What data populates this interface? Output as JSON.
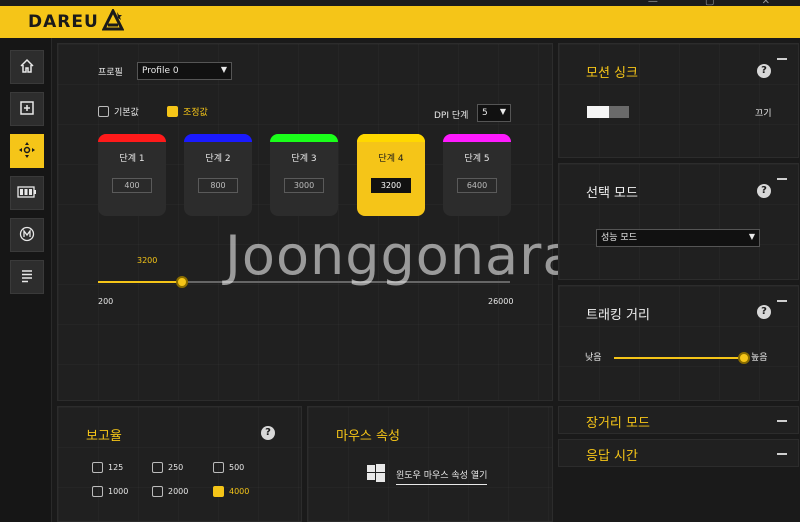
{
  "app": {
    "brand": "DAREU",
    "window_controls": "— ▢ ✕"
  },
  "sidebar": {
    "items": [
      {
        "name": "home",
        "icon": "home-icon",
        "glyph": "⌂"
      },
      {
        "name": "add",
        "icon": "plus-square-icon",
        "glyph": "⊞"
      },
      {
        "name": "dpi",
        "icon": "move-arrows-icon",
        "glyph": "✥"
      },
      {
        "name": "battery",
        "icon": "battery-icon",
        "glyph": "▮▮▮"
      },
      {
        "name": "macro",
        "icon": "macro-m-icon",
        "glyph": "Ⓜ"
      },
      {
        "name": "list",
        "icon": "list-icon",
        "glyph": "≡"
      }
    ],
    "active_index": 2
  },
  "dpi_panel": {
    "profile_label": "프로필",
    "profile_value": "Profile 0",
    "default_label": "기본값",
    "custom_label": "조정값",
    "default_checked": false,
    "custom_checked": true,
    "dpi_stage_label": "DPI 단계",
    "dpi_stage_value": "5",
    "stages": [
      {
        "label": "단계  1",
        "value": "400",
        "color": "#ff1a1a"
      },
      {
        "label": "단계  2",
        "value": "800",
        "color": "#1a1aff"
      },
      {
        "label": "단계  3",
        "value": "3000",
        "color": "#1aff1a"
      },
      {
        "label": "단계  4",
        "value": "3200",
        "color": "#ffd800"
      },
      {
        "label": "단계  5",
        "value": "6400",
        "color": "#ff1aff"
      }
    ],
    "active_stage": 3,
    "slider": {
      "value": "3200",
      "min": "200",
      "max": "26000"
    }
  },
  "motion_sync": {
    "title": "모션 싱크",
    "state_label": "끄기",
    "help": "?",
    "on": false
  },
  "select_mode": {
    "title": "선택 모드",
    "help": "?",
    "value": "성능 모드"
  },
  "tracking": {
    "title": "트래킹 거리",
    "help": "?",
    "low_label": "낮음",
    "high_label": "높음",
    "level": 1.0
  },
  "long_range": {
    "title": "장거리 모드"
  },
  "response": {
    "title": "응답 시간"
  },
  "report_rate": {
    "title": "보고율",
    "help": "?",
    "options": [
      "125",
      "250",
      "500",
      "1000",
      "2000",
      "4000"
    ],
    "selected": "4000"
  },
  "mouse_props": {
    "title": "마우스 속성",
    "link_label": "윈도우 마우스 속성 열기"
  },
  "watermark": "Joonggonara",
  "colors": {
    "accent": "#f5c518",
    "panel": "#202020",
    "background": "#1a1a1a"
  }
}
